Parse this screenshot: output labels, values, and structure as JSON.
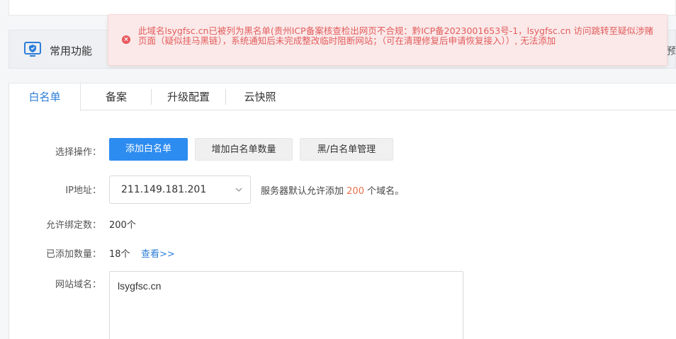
{
  "header": {
    "feature_title": "常用功能",
    "feature_cut_text": "预"
  },
  "alert": {
    "icon": "close-circle-icon",
    "message": "此域名lsygfsc.cn已被列为黑名单(贵州ICP备案核查检出网页不合规：黔ICP备2023001653号-1，lsygfsc.cn 访问跳转至疑似涉赌页面（疑似挂马黑链），系统通知后未完成整改临时阻断网站；（可在清理修复后申请恢复接入））, 无法添加",
    "color": "#e25b5b"
  },
  "tabs": [
    {
      "label": "白名单",
      "active": true
    },
    {
      "label": "备案",
      "active": false
    },
    {
      "label": "升级配置",
      "active": false
    },
    {
      "label": "云快照",
      "active": false
    }
  ],
  "form": {
    "operation_label": "选择操作：",
    "buttons": {
      "add_whitelist": "添加白名单",
      "increase_quota": "增加白名单数量",
      "manage_lists": "黑/白名单管理"
    },
    "ip_label": "IP地址：",
    "ip_value": "211.149.181.201",
    "hint_prefix": "服务器默认允许添加",
    "hint_number": "200",
    "hint_suffix": "个域名。",
    "allowed_label": "允许绑定数：",
    "allowed_value": "200个",
    "added_label": "已添加数量：",
    "added_value": "18个",
    "view_link": "查看>>",
    "domain_label": "网站域名：",
    "domain_value": "lsygfsc.cn"
  },
  "colors": {
    "primary": "#2d8cf0",
    "accent_link": "#2d7ed8",
    "highlight_number": "#e8704a"
  }
}
